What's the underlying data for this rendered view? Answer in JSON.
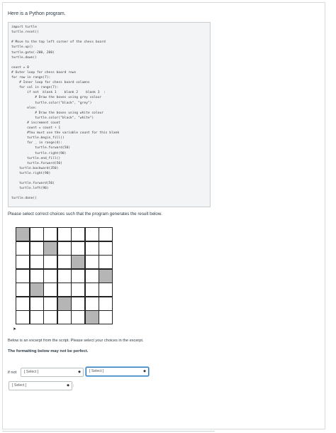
{
  "intro": "Here is a Python program.",
  "code": {
    "lines": [
      "import turtle",
      "turtle.reset()",
      "",
      "# Move to the top left corner of the chess board",
      "turtle.up()",
      "turtle.goto(-200, 200)",
      "turtle.down()",
      "",
      "count = 0",
      "# Outer loop for chess board rows",
      "for row in range(7):",
      "    # Inner loop for chess board columns",
      "    for col in range(7):",
      "        if not  blank 1    blank 2    blank 3  :",
      "            # Draw the boxes using grey colour",
      "            turtle.color(\"black\", \"grey\")",
      "        else:",
      "            # Draw the boxes using white colour",
      "            turtle.color(\"black\", \"white\")",
      "        # increment count",
      "        count = count + 1",
      "        #You must use the variable count for this blank",
      "        turtle.begin_fill()",
      "        for _ in range(4):",
      "            turtle.forward(50)",
      "            turtle.right(90)",
      "        turtle.end_fill()",
      "        turtle.forward(50)",
      "    turtle.backward(350)",
      "    turtle.right(90)",
      "",
      "    turtle.forward(50)",
      "    turtle.left(90)",
      "",
      "turtle.done()"
    ]
  },
  "question": "Please select correct choices such that the program generates the result below.",
  "board": {
    "rows": 7,
    "cols": 7,
    "grey_cells": [
      [
        0,
        0
      ],
      [
        1,
        2
      ],
      [
        2,
        4
      ],
      [
        3,
        6
      ],
      [
        4,
        1
      ],
      [
        5,
        3
      ],
      [
        6,
        5
      ]
    ],
    "grey_color": "#b5b5b5"
  },
  "excerpt_text": "Below is an excerpt from the script. Please select your choices in the excerpt.",
  "format_note": "The formatting below may not be perfect.",
  "answer": {
    "prefix": "if not",
    "select1": "[ Select ]",
    "select2": "[ Select ]",
    "select3": "[ Select ]",
    "suffix": ":"
  }
}
